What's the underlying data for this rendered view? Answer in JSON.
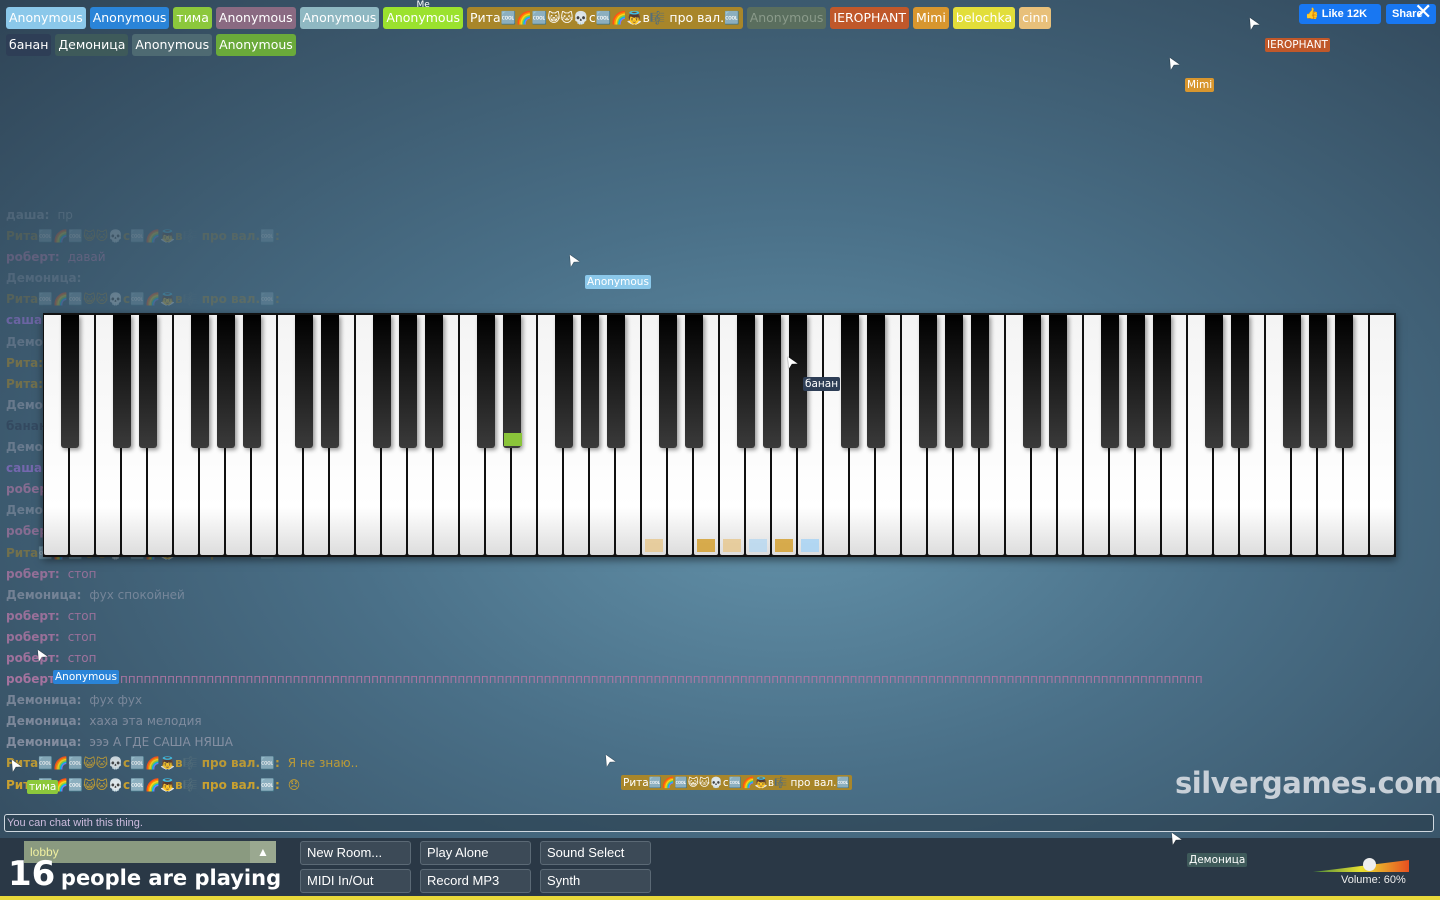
{
  "participants_row1": [
    {
      "name": "Anonymous",
      "color": "#8bc8ea"
    },
    {
      "name": "Anonymous",
      "color": "#2a84d8"
    },
    {
      "name": "тима",
      "color": "#8cc83c"
    },
    {
      "name": "Anonymous",
      "color": "#8a6a82"
    },
    {
      "name": "Anonymous",
      "color": "#8fb8c2"
    },
    {
      "name": "Anonymous",
      "color": "#9be22e",
      "me": "Me"
    },
    {
      "name": "Рита🆒🌈🆒😺🐱💀с🆒🌈👼в🎼 про вал.🆒",
      "color": "#a8862a"
    },
    {
      "name": "Anonymous",
      "color": "#5a6e5e",
      "muted": true
    },
    {
      "name": "IEROPHANT",
      "color": "#c0582a"
    },
    {
      "name": "Mimi",
      "color": "#d8962e"
    },
    {
      "name": "belochka",
      "color": "#e2de3a"
    },
    {
      "name": "cinn",
      "color": "#e8c07a"
    }
  ],
  "participants_row2": [
    {
      "name": "банан",
      "color": "#2e3e56"
    },
    {
      "name": "Демоница",
      "color": "#3e5a5a"
    },
    {
      "name": "Anonymous",
      "color": "#4e6a72"
    },
    {
      "name": "Anonymous",
      "color": "#6aaa3a"
    }
  ],
  "social": {
    "like": "Like 12K",
    "share": "Share"
  },
  "chat": [
    {
      "name": "даша:",
      "msg": "пр",
      "color": "rgba(200,200,210,.45)",
      "opacity": 0.35
    },
    {
      "name": "Рита🆒🌈🆒😺🐱💀с🆒🌈👼в🎼 про вал.🆒:",
      "msg": "",
      "color": "#a8862a",
      "opacity": 0.2
    },
    {
      "name": "роберт:",
      "msg": "давай",
      "color": "#b878a8",
      "opacity": 0.3
    },
    {
      "name": "Демоница:",
      "msg": "",
      "color": "#aab",
      "opacity": 0.2
    },
    {
      "name": "Рита🆒🌈🆒😺🐱💀с🆒🌈👼в🎼 про вал.🆒:",
      "msg": "",
      "color": "#a8862a",
      "opacity": 0.25
    },
    {
      "name": "саша:",
      "msg": "",
      "color": "#9a70d8",
      "opacity": 0.5
    },
    {
      "name": "Демоница:",
      "msg": "",
      "color": "#aab",
      "opacity": 0.3
    },
    {
      "name": "Рита:",
      "msg": "",
      "color": "#a8862a",
      "opacity": 0.5
    },
    {
      "name": "Рита:",
      "msg": "",
      "color": "#a8862a",
      "opacity": 0.5
    },
    {
      "name": "Демоница:",
      "msg": "",
      "color": "#aab",
      "opacity": 0.4
    },
    {
      "name": "банан:",
      "msg": "",
      "color": "#2e3e56",
      "opacity": 0.6
    },
    {
      "name": "Демоница:",
      "msg": "",
      "color": "#aab",
      "opacity": 0.4
    },
    {
      "name": "саша:",
      "msg": "",
      "color": "#9a70d8",
      "opacity": 0.6
    },
    {
      "name": "роберт:",
      "msg": "",
      "color": "#b878a8",
      "opacity": 0.6
    },
    {
      "name": "Демоница:",
      "msg": "",
      "color": "#aab",
      "opacity": 0.4
    },
    {
      "name": "роберт:",
      "msg": "",
      "color": "#b878a8",
      "opacity": 0.6
    },
    {
      "name": "Рита🆒🌈🆒😺🐱💀с🆒🌈👼в🎼 про вал.🆒:",
      "msg": "",
      "color": "#a8862a",
      "opacity": 0.5
    },
    {
      "name": "роберт:",
      "msg": "стоп",
      "color": "#b878a8",
      "opacity": 0.7
    },
    {
      "name": "Демоница:",
      "msg": "фух спокойней",
      "color": "#aab",
      "opacity": 0.5
    },
    {
      "name": "роберт:",
      "msg": "стоп",
      "color": "#b878a8",
      "opacity": 0.75
    },
    {
      "name": "роберт:",
      "msg": "стоп",
      "color": "#b878a8",
      "opacity": 0.75
    },
    {
      "name": "роберт:",
      "msg": "стоп",
      "color": "#b878a8",
      "opacity": 0.8
    },
    {
      "name": "роберт:",
      "msg": "стопппппппппппппппппппппппппппппппппппппппппппппппппппппппппппппппппппппппппппппппппппппппппппппппппппппппппппппппппппппппппппппппппппппппппппппп",
      "color": "#b878a8",
      "opacity": 0.85
    },
    {
      "name": "Демоница:",
      "msg": "фух фух",
      "color": "#aab",
      "opacity": 0.55
    },
    {
      "name": "Демоница:",
      "msg": "хаха эта мелодия",
      "color": "#aab",
      "opacity": 0.6
    },
    {
      "name": "Демоница:",
      "msg": "эээ А ГДЕ САША НЯША",
      "color": "#aab",
      "opacity": 0.65
    },
    {
      "name": "Рита🆒🌈🆒😺🐱💀с🆒🌈👼в🎼 про вал.🆒:",
      "msg": "Я не знаю..",
      "color": "#c8a030",
      "opacity": 0.9
    },
    {
      "name": "Рита🆒🌈🆒😺🐱💀с🆒🌈👼в🎼 про вал.🆒:",
      "msg": "😞",
      "color": "#c8a030",
      "opacity": 1
    }
  ],
  "piano": {
    "first_note": "A0",
    "keys": 88,
    "pressed": [
      {
        "note": "D#3",
        "color": "#8ac43a"
      },
      {
        "note": "C4",
        "color": "#e6c890"
      },
      {
        "note": "E4",
        "color": "#d4a030"
      },
      {
        "note": "F4",
        "color": "#e6c890"
      },
      {
        "note": "G4",
        "color": "#b8d8f0"
      },
      {
        "note": "A4",
        "color": "#d4a030"
      },
      {
        "note": "B4",
        "color": "#a8d4f4"
      }
    ]
  },
  "cursors": [
    {
      "name": "IEROPHANT",
      "color": "#c0582a"
    },
    {
      "name": "Mimi",
      "color": "#d8962e"
    },
    {
      "name": "Anonymous",
      "color": "#8bc8ea"
    },
    {
      "name": "банан",
      "color": "#2e3e56"
    },
    {
      "name": "Anonymous",
      "color": "#2a84d8"
    },
    {
      "name": "тима",
      "color": "#8cc83c"
    },
    {
      "name": "Рита🆒🌈🆒😺🐱💀с🆒🌈👼в🎼 про вал.🆒",
      "color": "#a8862a"
    },
    {
      "name": "Демоница",
      "color": "#3e5a5a"
    }
  ],
  "logo": "silvergames.com",
  "chat_placeholder": "You can chat with this thing.",
  "room": {
    "name": "lobby",
    "count": "16",
    "count_label": "people are playing"
  },
  "buttons": [
    "New Room...",
    "Play Alone",
    "Sound Select",
    "MIDI In/Out",
    "Record MP3",
    "Synth"
  ],
  "volume": {
    "label": "Volume: 60%",
    "value": 60
  }
}
